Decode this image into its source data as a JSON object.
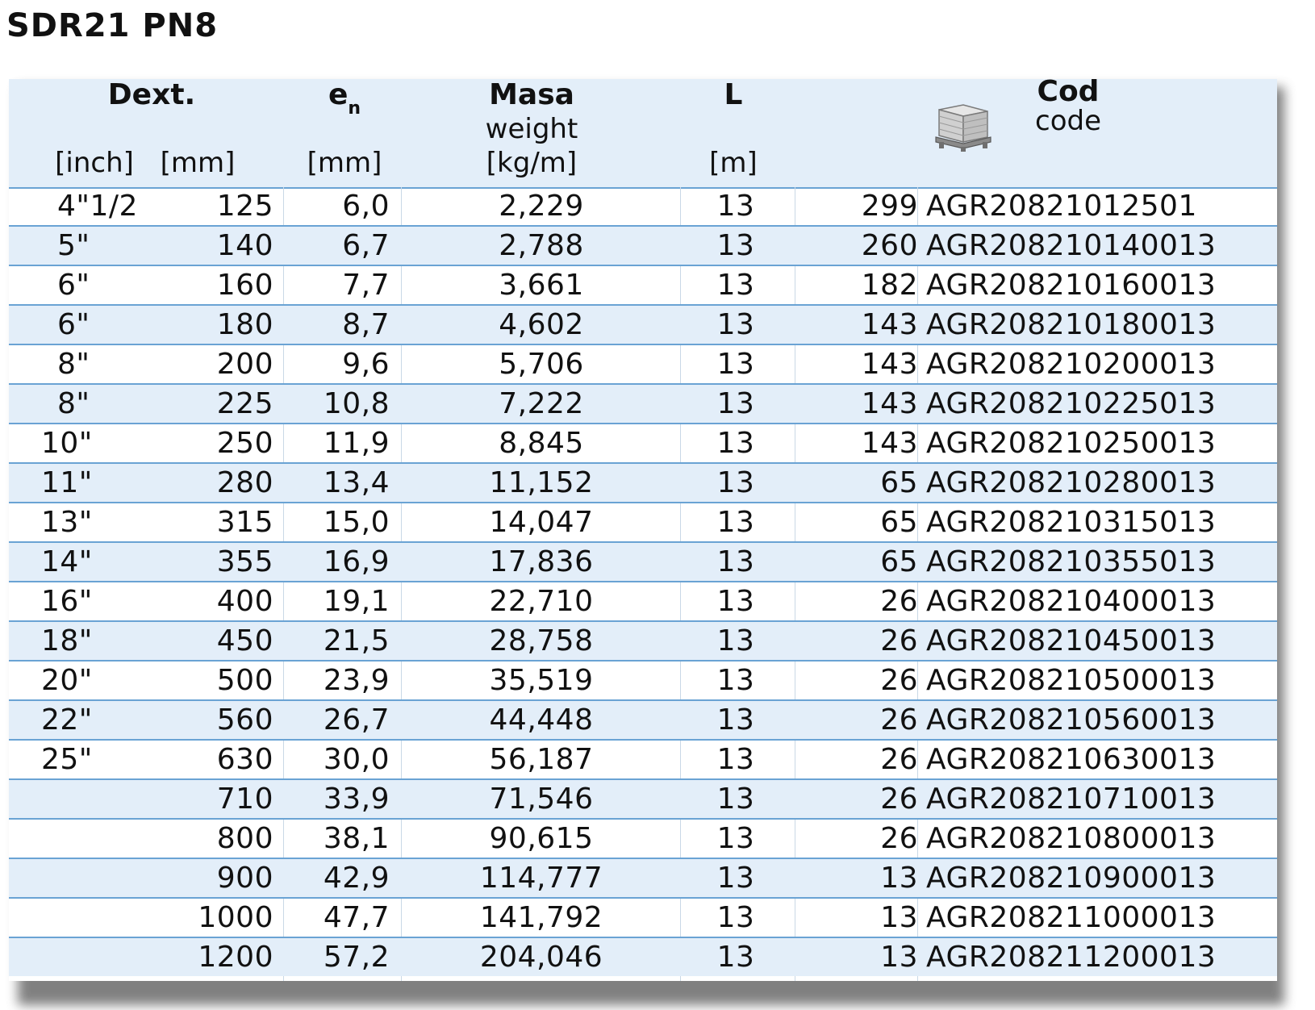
{
  "page_heading": {
    "title": "SDR21 PN8"
  },
  "table": {
    "headers": {
      "dext": "Dext.",
      "en_main": "e",
      "en_sub": "n",
      "masa": "Masa",
      "weight": "weight",
      "l": "L",
      "cod": "Cod",
      "code": "code",
      "unit_inch": "[inch]",
      "unit_mm": "[mm]",
      "unit_en": "[mm]",
      "unit_mass": "[kg/m]",
      "unit_l": "[m]",
      "pallet_icon": "pallet-icon"
    },
    "colors": {
      "header_bg": "#e3eef9",
      "alt_row_bg": "#e3eef9",
      "row_border": "#6aa3d4"
    },
    "rows": [
      {
        "inch": "4\"1/2",
        "mm": "125",
        "en": "6,0",
        "mass": "2,229",
        "l": "13",
        "pallet": "299",
        "code": "AGR20821012501"
      },
      {
        "inch": "5\"",
        "mm": "140",
        "en": "6,7",
        "mass": "2,788",
        "l": "13",
        "pallet": "260",
        "code": "AGR208210140013"
      },
      {
        "inch": "6\"",
        "mm": "160",
        "en": "7,7",
        "mass": "3,661",
        "l": "13",
        "pallet": "182",
        "code": "AGR208210160013"
      },
      {
        "inch": "6\"",
        "mm": "180",
        "en": "8,7",
        "mass": "4,602",
        "l": "13",
        "pallet": "143",
        "code": "AGR208210180013"
      },
      {
        "inch": "8\"",
        "mm": "200",
        "en": "9,6",
        "mass": "5,706",
        "l": "13",
        "pallet": "143",
        "code": "AGR208210200013"
      },
      {
        "inch": "8\"",
        "mm": "225",
        "en": "10,8",
        "mass": "7,222",
        "l": "13",
        "pallet": "143",
        "code": "AGR208210225013"
      },
      {
        "inch": "10\"",
        "mm": "250",
        "en": "11,9",
        "mass": "8,845",
        "l": "13",
        "pallet": "143",
        "code": "AGR208210250013"
      },
      {
        "inch": "11\"",
        "mm": "280",
        "en": "13,4",
        "mass": "11,152",
        "l": "13",
        "pallet": "65",
        "code": "AGR208210280013"
      },
      {
        "inch": "13\"",
        "mm": "315",
        "en": "15,0",
        "mass": "14,047",
        "l": "13",
        "pallet": "65",
        "code": "AGR208210315013"
      },
      {
        "inch": "14\"",
        "mm": "355",
        "en": "16,9",
        "mass": "17,836",
        "l": "13",
        "pallet": "65",
        "code": "AGR208210355013"
      },
      {
        "inch": "16\"",
        "mm": "400",
        "en": "19,1",
        "mass": "22,710",
        "l": "13",
        "pallet": "26",
        "code": "AGR208210400013"
      },
      {
        "inch": "18\"",
        "mm": "450",
        "en": "21,5",
        "mass": "28,758",
        "l": "13",
        "pallet": "26",
        "code": "AGR208210450013"
      },
      {
        "inch": "20\"",
        "mm": "500",
        "en": "23,9",
        "mass": "35,519",
        "l": "13",
        "pallet": "26",
        "code": "AGR208210500013"
      },
      {
        "inch": "22\"",
        "mm": "560",
        "en": "26,7",
        "mass": "44,448",
        "l": "13",
        "pallet": "26",
        "code": "AGR208210560013"
      },
      {
        "inch": "25\"",
        "mm": "630",
        "en": "30,0",
        "mass": "56,187",
        "l": "13",
        "pallet": "26",
        "code": "AGR208210630013"
      },
      {
        "inch": "",
        "mm": "710",
        "en": "33,9",
        "mass": "71,546",
        "l": "13",
        "pallet": "26",
        "code": "AGR208210710013"
      },
      {
        "inch": "",
        "mm": "800",
        "en": "38,1",
        "mass": "90,615",
        "l": "13",
        "pallet": "26",
        "code": "AGR208210800013"
      },
      {
        "inch": "",
        "mm": "900",
        "en": "42,9",
        "mass": "114,777",
        "l": "13",
        "pallet": "13",
        "code": "AGR208210900013"
      },
      {
        "inch": "",
        "mm": "1000",
        "en": "47,7",
        "mass": "141,792",
        "l": "13",
        "pallet": "13",
        "code": "AGR208211000013"
      },
      {
        "inch": "",
        "mm": "1200",
        "en": "57,2",
        "mass": "204,046",
        "l": "13",
        "pallet": "13",
        "code": "AGR208211200013"
      }
    ]
  }
}
